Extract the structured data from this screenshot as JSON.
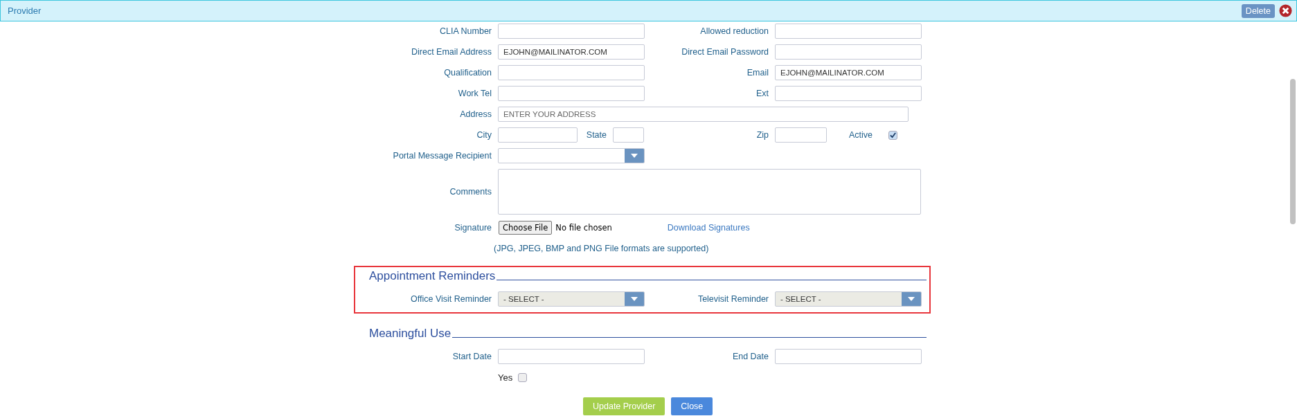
{
  "window": {
    "title": "Provider",
    "delete_button": "Delete"
  },
  "form_rows": [
    {
      "kind": "pair",
      "left": {
        "label": "CLIA Number"
      },
      "right": {
        "label": "Allowed reduction"
      }
    },
    {
      "kind": "pair",
      "left": {
        "label": "Direct Email Address",
        "value": "EJOHN@MAILINATOR.COM"
      },
      "right": {
        "label": "Direct Email Password"
      }
    },
    {
      "kind": "pair",
      "left": {
        "label": "Qualification"
      },
      "right": {
        "label": "Email",
        "value": "EJOHN@MAILINATOR.COM"
      }
    },
    {
      "kind": "pair",
      "left": {
        "label": "Work Tel"
      },
      "right": {
        "label": "Ext"
      }
    },
    {
      "kind": "wide",
      "label": "Address",
      "placeholder": "ENTER YOUR ADDRESS"
    },
    {
      "kind": "location",
      "city": {
        "label": "City"
      },
      "state": {
        "label": "State"
      },
      "zip": {
        "label": "Zip"
      },
      "active": {
        "label": "Active",
        "checked": true
      }
    },
    {
      "kind": "select",
      "label": "Portal Message Recipient"
    },
    {
      "kind": "textarea",
      "label": "Comments"
    },
    {
      "kind": "file",
      "label": "Signature",
      "button": "Choose File",
      "status": "No file chosen",
      "link": "Download Signatures",
      "note": "(JPG, JPEG, BMP and PNG File formats are supported)"
    }
  ],
  "sections": [
    {
      "title": "Appointment Reminders",
      "highlighted": true,
      "rows": [
        {
          "kind": "select_pair",
          "left": {
            "label": "Office Visit Reminder",
            "value": "- SELECT -"
          },
          "right": {
            "label": "Televisit Reminder",
            "value": "- SELECT -"
          }
        }
      ]
    },
    {
      "title": "Meaningful Use",
      "highlighted": false,
      "rows": [
        {
          "kind": "pair",
          "left": {
            "label": "Start Date"
          },
          "right": {
            "label": "End Date"
          }
        },
        {
          "kind": "checkbox",
          "label": "Yes",
          "checked": false
        }
      ]
    }
  ],
  "buttons": [
    {
      "label": "Update Provider",
      "kind": "primary"
    },
    {
      "label": "Close",
      "kind": "secondary"
    }
  ]
}
